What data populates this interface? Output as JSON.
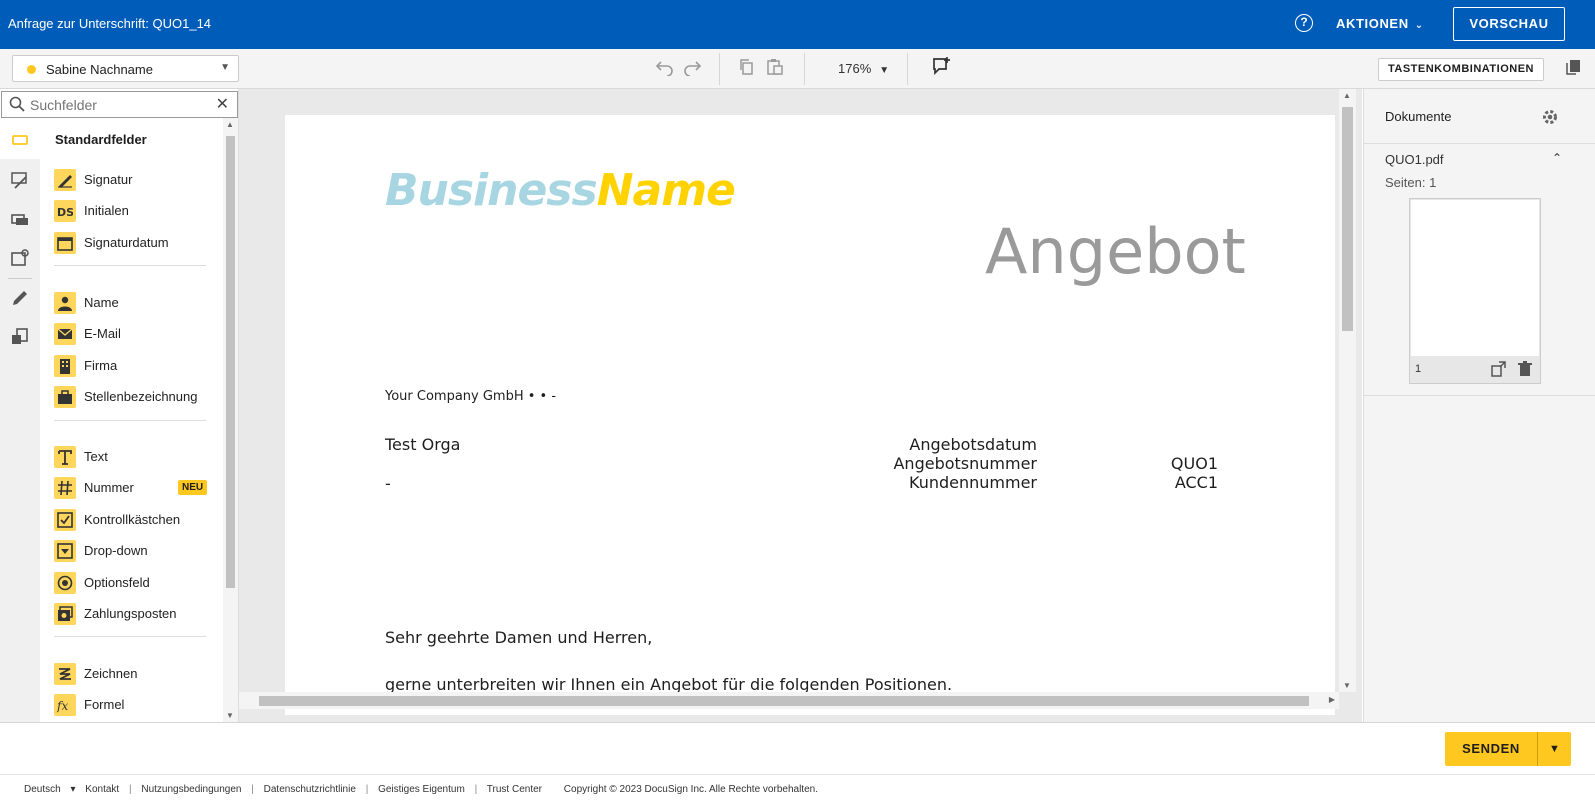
{
  "header": {
    "title": "Anfrage zur Unterschrift: QUO1_14",
    "help_icon": "?",
    "actions_label": "AKTIONEN",
    "preview_label": "VORSCHAU"
  },
  "toolbar": {
    "recipient_name": "Sabine Nachname",
    "recipient_color": "#ffc820",
    "zoom": "176%",
    "shortcuts_label": "TASTENKOMBINATIONEN"
  },
  "search": {
    "placeholder": "Suchfelder"
  },
  "palette": {
    "section_title": "Standardfelder",
    "groups": [
      [
        {
          "label": "Signatur",
          "icon": "signature-icon"
        },
        {
          "label": "Initialen",
          "icon": "initials-icon"
        },
        {
          "label": "Signaturdatum",
          "icon": "calendar-icon"
        }
      ],
      [
        {
          "label": "Name",
          "icon": "person-icon"
        },
        {
          "label": "E-Mail",
          "icon": "envelope-icon"
        },
        {
          "label": "Firma",
          "icon": "building-icon"
        },
        {
          "label": "Stellenbezeichnung",
          "icon": "briefcase-icon"
        }
      ],
      [
        {
          "label": "Text",
          "icon": "text-icon"
        },
        {
          "label": "Nummer",
          "icon": "hash-icon",
          "badge": "NEU"
        },
        {
          "label": "Kontrollkästchen",
          "icon": "checkbox-icon"
        },
        {
          "label": "Drop-down",
          "icon": "dropdown-icon"
        },
        {
          "label": "Optionsfeld",
          "icon": "radio-icon"
        },
        {
          "label": "Zahlungsposten",
          "icon": "payment-icon"
        }
      ],
      [
        {
          "label": "Zeichnen",
          "icon": "draw-icon"
        },
        {
          "label": "Formel",
          "icon": "formula-icon"
        }
      ]
    ]
  },
  "document": {
    "logo_part1": "Business",
    "logo_part2": "Name",
    "title": "Angebot",
    "company_line": "Your Company GmbH •  • -",
    "recipient_org": "Test Orga",
    "recipient_dash": "-",
    "fields": [
      {
        "label": "Angebotsdatum",
        "value": ""
      },
      {
        "label": "Angebotsnummer",
        "value": "QUO1"
      },
      {
        "label": "Kundennummer",
        "value": "ACC1"
      }
    ],
    "greeting": "Sehr geehrte Damen und Herren,",
    "body_line": "gerne unterbreiten wir Ihnen ein Angebot für die folgenden Positionen."
  },
  "right_panel": {
    "title": "Dokumente",
    "file_name": "QUO1.pdf",
    "pages_label": "Seiten: 1",
    "page_number": "1"
  },
  "bottom": {
    "send_label": "SENDEN"
  },
  "footer": {
    "language": "Deutsch",
    "links": [
      "Kontakt",
      "Nutzungsbedingungen",
      "Datenschutzrichtlinie",
      "Geistiges Eigentum",
      "Trust Center"
    ],
    "copyright": "Copyright © 2023 DocuSign Inc. Alle Rechte vorbehalten."
  },
  "colors": {
    "header_blue": "#005cb9",
    "accent_yellow": "#ffc820",
    "field_icon_bg": "#ffd65c",
    "logo_blue": "#a8d5e2",
    "logo_yellow": "#ffd200"
  }
}
